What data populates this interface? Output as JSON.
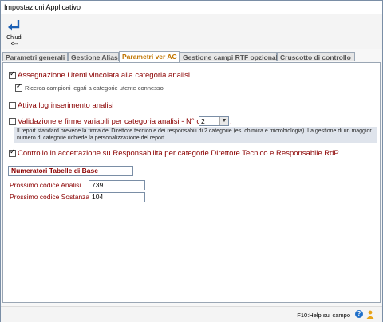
{
  "window": {
    "title": "Impostazioni Applicativo"
  },
  "toolbar": {
    "close_label": "Chiudi\n<--"
  },
  "tabs": [
    {
      "label": "Parametri generali"
    },
    {
      "label": "Gestione Alias"
    },
    {
      "label": "Parametri ver AC"
    },
    {
      "label": "Gestione campi RTF opzionali"
    },
    {
      "label": "Cruscotto di controllo"
    }
  ],
  "active_tab": 2,
  "options": {
    "assegnazione": {
      "label": "Assegnazione Utenti vincolata alla categoria analisi",
      "checked": true
    },
    "ricerca": {
      "label": "Ricerca campioni legati a categorie utente connesso",
      "checked": true
    },
    "attiva_log": {
      "label": "Attiva log inserimento analisi",
      "checked": false
    },
    "validazione": {
      "label": "Validazione e firme variabili per categoria analisi - N° categorie :",
      "checked": false,
      "value": "2"
    },
    "validazione_note": "Il report standard prevede la firma del Direttore tecnico e dei responsabili di 2 categorie (es. chimica e microbiologia). La gestione di un maggior numero di categorie richiede la personalizzazione del report",
    "controllo": {
      "label": "Controllo in accettazione su Responsabilità per categorie Direttore Tecnico e Responsabile RdP",
      "checked": true
    }
  },
  "numeratori": {
    "title": "Numeratori Tabelle di Base",
    "analisi_label": "Prossimo codice Analisi",
    "analisi_value": "739",
    "sostanza_label": "Prossimo codice Sostanza",
    "sostanza_value": "104"
  },
  "status": {
    "text": "F10:Help sul campo"
  }
}
